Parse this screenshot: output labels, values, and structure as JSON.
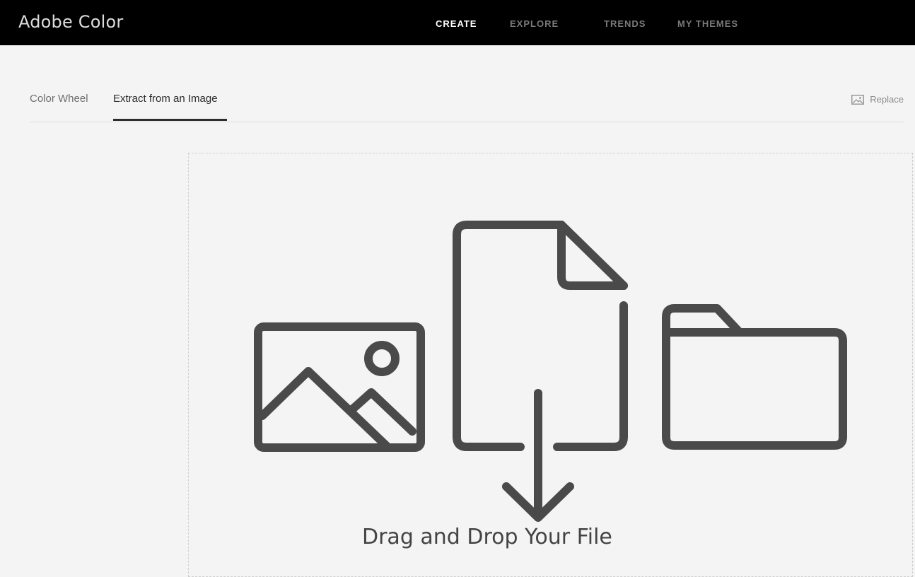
{
  "app": {
    "title": "Adobe Color"
  },
  "nav": {
    "items": [
      {
        "label": "CREATE",
        "active": true
      },
      {
        "label": "EXPLORE",
        "active": false
      },
      {
        "label": "TRENDS",
        "active": false
      },
      {
        "label": "MY THEMES",
        "active": false
      }
    ]
  },
  "tabs": {
    "items": [
      {
        "label": "Color Wheel",
        "active": false
      },
      {
        "label": "Extract from an Image",
        "active": true
      }
    ],
    "replace_label": "Replace"
  },
  "dropzone": {
    "text": "Drag and Drop Your File",
    "icons": [
      "image-icon",
      "file-download-icon",
      "folder-icon"
    ]
  },
  "colors": {
    "topbar": "#000000",
    "background": "#f4f4f4",
    "icon_stroke": "#4a4a4a",
    "nav_active": "#ffffff",
    "nav_inactive": "#7a7a7a"
  }
}
